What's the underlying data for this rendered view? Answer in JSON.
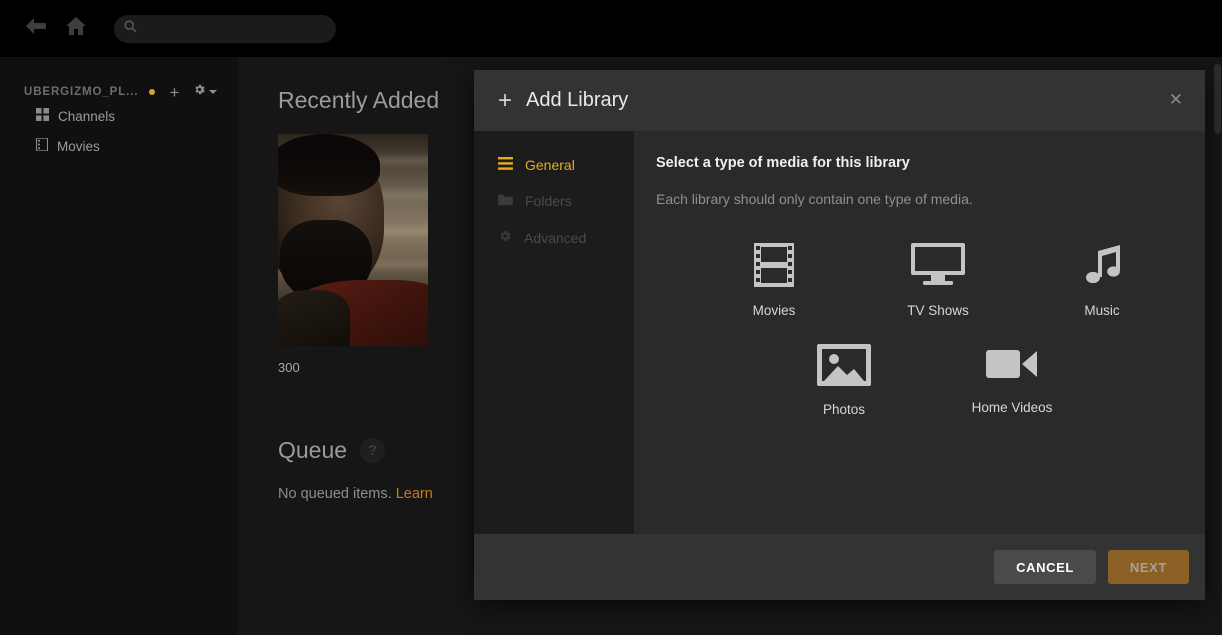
{
  "topbar": {
    "back_icon": "arrow-left-icon",
    "home_icon": "home-icon",
    "search_placeholder": "",
    "search_value": "",
    "search_icon": "search-icon"
  },
  "sidebar": {
    "server_name": "UBERGIZMO_PL...",
    "status_dot_color": "#d8a328",
    "add_label": "+",
    "gear_icon": "gear-icon",
    "items": [
      {
        "label": "Channels",
        "icon": "grid-icon"
      },
      {
        "label": "Movies",
        "icon": "film-icon"
      }
    ]
  },
  "main": {
    "recently_added_title": "Recently Added",
    "poster_title": "300",
    "queue_title": "Queue",
    "queue_help_icon": "question-mark-icon",
    "queue_empty_text": "No queued items. ",
    "queue_link_text": "Learn"
  },
  "modal": {
    "title": "Add Library",
    "plus_icon": "plus-icon",
    "close_icon": "close-icon",
    "nav": [
      {
        "label": "General",
        "icon": "hamburger-icon",
        "active": true
      },
      {
        "label": "Folders",
        "icon": "folder-icon",
        "active": false
      },
      {
        "label": "Advanced",
        "icon": "gear-icon",
        "active": false
      }
    ],
    "heading": "Select a type of media for this library",
    "subheading": "Each library should only contain one type of media.",
    "media_types": [
      {
        "label": "Movies",
        "icon": "film-strip-icon"
      },
      {
        "label": "TV Shows",
        "icon": "tv-monitor-icon"
      },
      {
        "label": "Music",
        "icon": "music-note-icon"
      },
      {
        "label": "Photos",
        "icon": "photo-icon"
      },
      {
        "label": "Home Videos",
        "icon": "video-camera-icon"
      }
    ],
    "cancel_label": "CANCEL",
    "next_label": "NEXT",
    "accent_color": "#e6ac1c",
    "next_button_color": "#8a6024"
  }
}
